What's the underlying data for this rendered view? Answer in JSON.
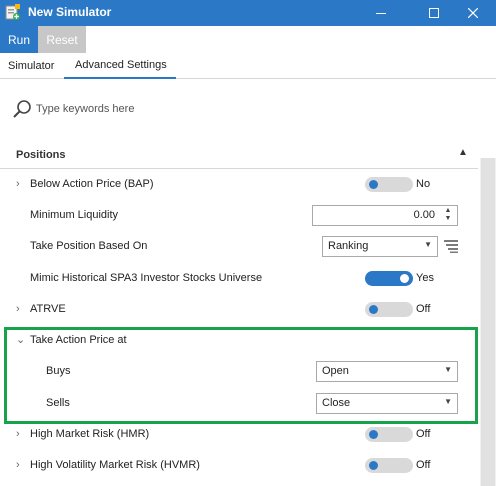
{
  "window": {
    "title": "New Simulator",
    "minimize_icon": "minimize-icon",
    "maximize_icon": "maximize-icon",
    "close_icon": "close-icon",
    "colors": {
      "titlebar": "#2b78c6",
      "accent": "#2b78c6",
      "highlight": "#16a34a"
    }
  },
  "ribbon": {
    "run_label": "Run",
    "reset_label": "Reset"
  },
  "tabs": [
    {
      "label": "Simulator",
      "active": false
    },
    {
      "label": "Advanced Settings",
      "active": true
    }
  ],
  "search": {
    "placeholder": "Type keywords here",
    "value": ""
  },
  "section": {
    "title": "Positions",
    "collapsed": false
  },
  "rows": {
    "bap": {
      "label": "Below Action Price (BAP)",
      "toggle_label": "No",
      "toggle_on": false
    },
    "min_liquidity": {
      "label": "Minimum Liquidity",
      "value": "0.00"
    },
    "take_position": {
      "label": "Take Position Based On",
      "value": "Ranking"
    },
    "mimic": {
      "label": "Mimic Historical SPA3 Investor Stocks Universe",
      "toggle_label": "Yes",
      "toggle_on": true
    },
    "atrve": {
      "label": "ATRVE",
      "toggle_label": "Off",
      "toggle_on": false
    },
    "take_action": {
      "label": "Take Action Price at"
    },
    "buys": {
      "label": "Buys",
      "value": "Open"
    },
    "sells": {
      "label": "Sells",
      "value": "Close"
    },
    "hmr": {
      "label": "High Market Risk (HMR)",
      "toggle_label": "Off",
      "toggle_on": false
    },
    "hvmr": {
      "label": "High Volatility Market Risk (HVMR)",
      "toggle_label": "Off",
      "toggle_on": false
    }
  }
}
